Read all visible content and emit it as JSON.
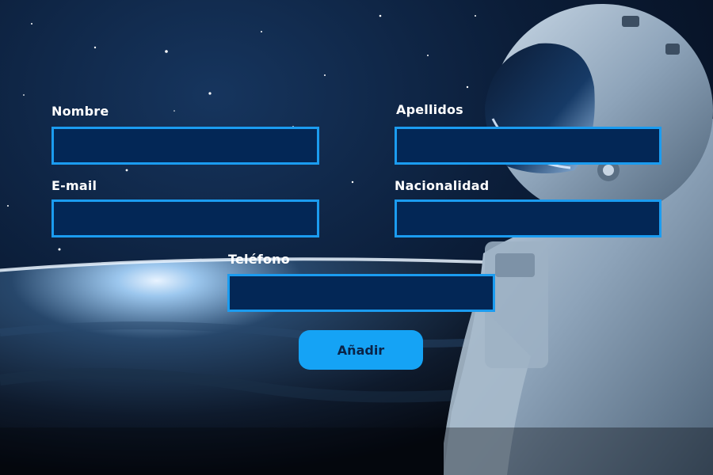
{
  "form": {
    "nombre": {
      "label": "Nombre",
      "value": "",
      "placeholder": ""
    },
    "apellidos": {
      "label": "Apellidos",
      "value": "",
      "placeholder": ""
    },
    "email": {
      "label": "E-mail",
      "value": "",
      "placeholder": ""
    },
    "nacionalidad": {
      "label": "Nacionalidad",
      "value": "",
      "placeholder": ""
    },
    "telefono": {
      "label": "Teléfono",
      "value": "",
      "placeholder": ""
    },
    "submit_label": "Añadir"
  },
  "colors": {
    "input_background": "#032756",
    "input_border": "#1b9cf0",
    "button_background": "#15a3f5",
    "button_text": "#0a2347",
    "label_text": "#ffffff"
  }
}
